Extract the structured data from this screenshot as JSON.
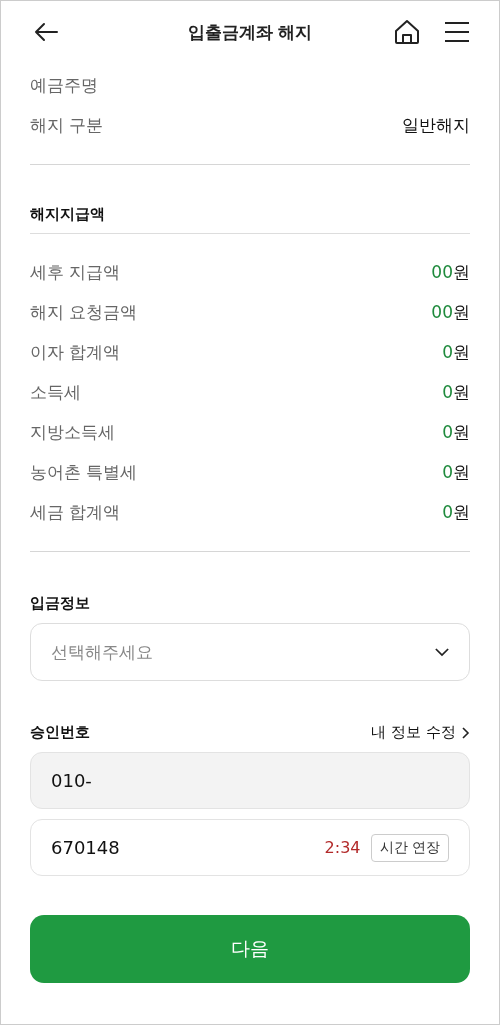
{
  "header": {
    "title": "입출금계좌 해지"
  },
  "account_info": [
    {
      "label": "예금주명"
    },
    {
      "label": "해지 구분",
      "value": "일반해지"
    }
  ],
  "payout": {
    "title": "해지지급액",
    "rows": [
      {
        "label": "세후 지급액",
        "amount": "00",
        "unit": "원"
      },
      {
        "label": "해지 요청금액",
        "amount": "00",
        "unit": "원"
      },
      {
        "label": "이자 합계액",
        "amount": "0",
        "unit": "원"
      },
      {
        "label": "소득세",
        "amount": "0",
        "unit": "원"
      },
      {
        "label": "지방소득세",
        "amount": "0",
        "unit": "원"
      },
      {
        "label": "농어촌 특별세",
        "amount": "0",
        "unit": "원"
      },
      {
        "label": "세금 합계액",
        "amount": "0",
        "unit": "원"
      }
    ]
  },
  "deposit": {
    "title": "입금정보",
    "select": {
      "placeholder": "선택해주세요"
    }
  },
  "approval": {
    "title": "승인번호",
    "edit_link": "내 정보 수정",
    "phone": {
      "value": "010-",
      "disabled": true
    },
    "code": {
      "value": "670148",
      "timer": "2:34",
      "extend_button": "시간 연장"
    }
  },
  "next_button": "다음"
}
